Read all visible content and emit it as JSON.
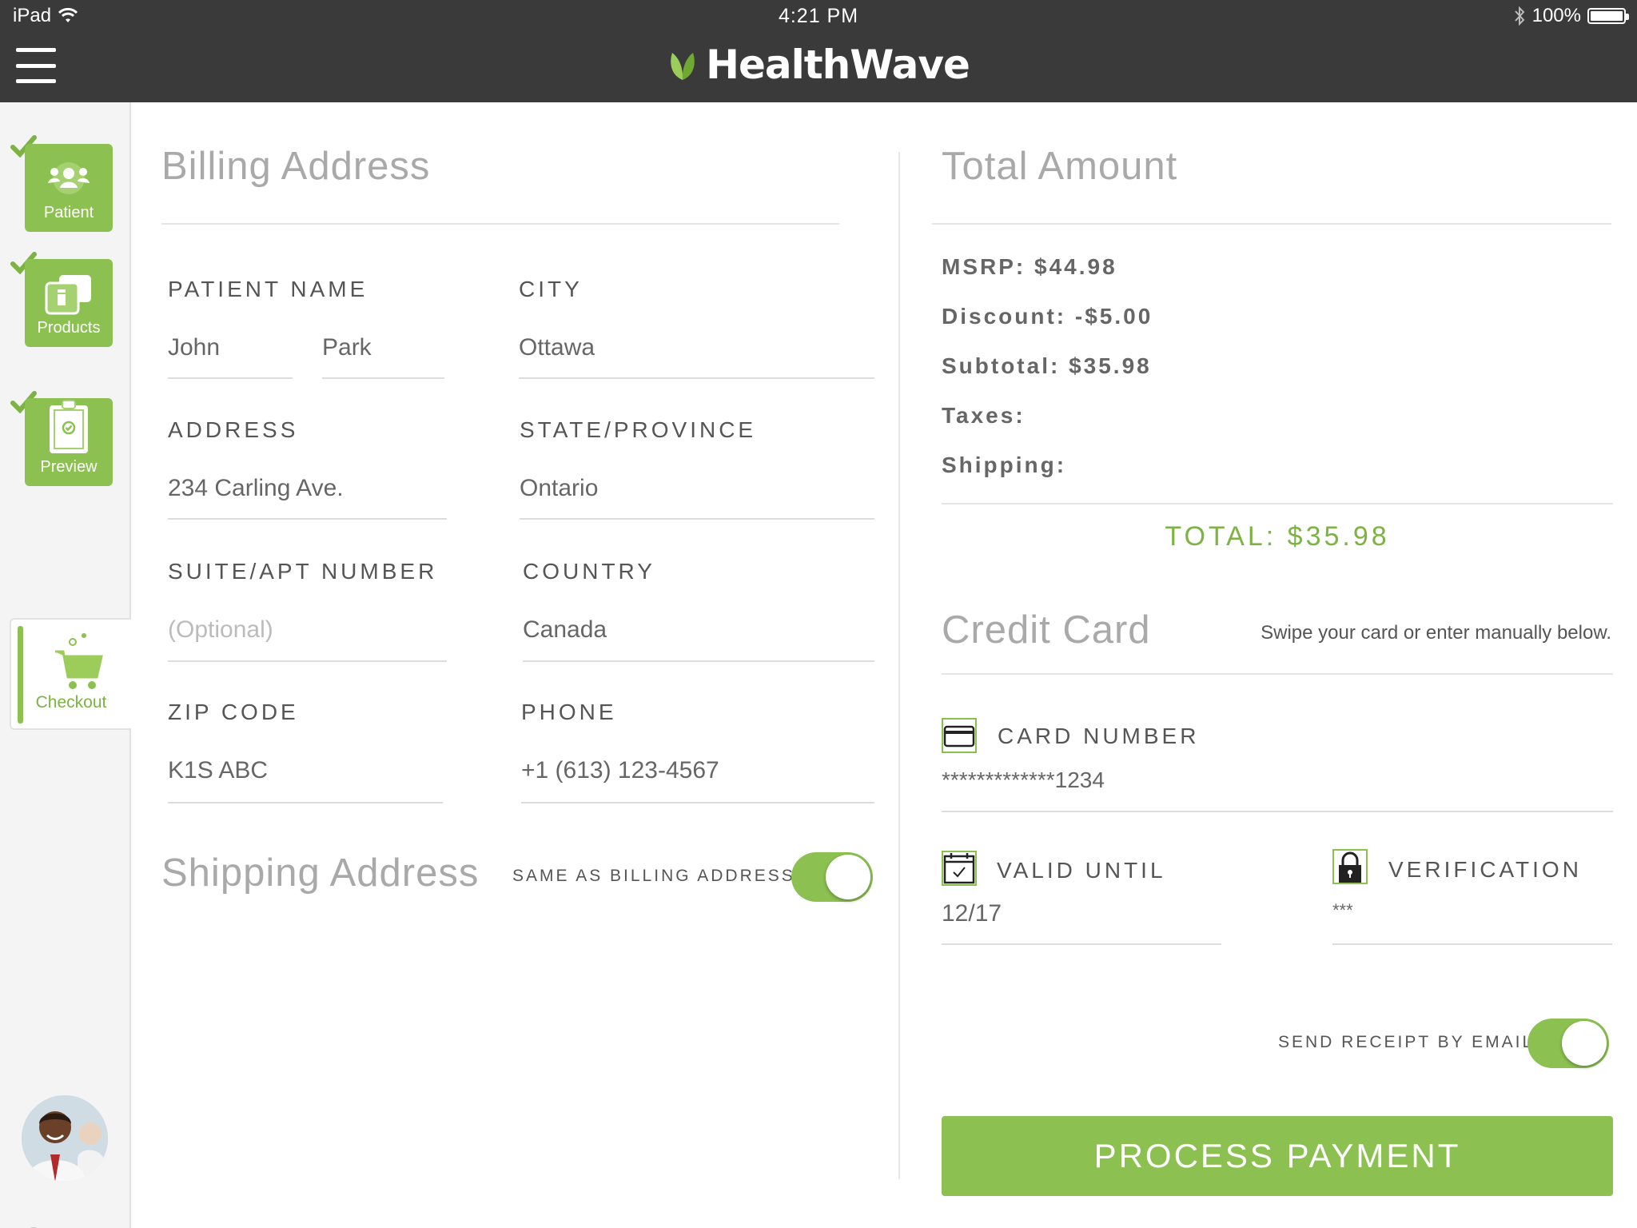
{
  "status_bar": {
    "device": "iPad",
    "time": "4:21 PM",
    "battery": "100%"
  },
  "header": {
    "brand": "HealthWave"
  },
  "sidebar": {
    "steps": [
      {
        "label": "Patient",
        "icon": "patient-icon",
        "completed": true
      },
      {
        "label": "Products",
        "icon": "products-icon",
        "completed": true
      },
      {
        "label": "Preview",
        "icon": "preview-icon",
        "completed": true
      },
      {
        "label": "Checkout",
        "icon": "cart-icon",
        "active": true
      }
    ],
    "step_indicator": "Step 4"
  },
  "billing": {
    "title": "Billing Address",
    "patient_name_label": "PATIENT NAME",
    "first_name": "John",
    "last_name": "Park",
    "city_label": "CITY",
    "city": "Ottawa",
    "address_label": "ADDRESS",
    "address": "234 Carling Ave.",
    "state_label": "STATE/PROVINCE",
    "state": "Ontario",
    "suite_label": "SUITE/APT NUMBER",
    "suite_placeholder": "(Optional)",
    "country_label": "COUNTRY",
    "country": "Canada",
    "zip_label": "ZIP CODE",
    "zip": "K1S ABC",
    "phone_label": "PHONE",
    "phone": "+1 (613) 123-4567"
  },
  "shipping": {
    "title": "Shipping Address",
    "same_as_billing_label": "SAME AS BILLING ADDRESS",
    "same_as_billing": true
  },
  "totals": {
    "title": "Total Amount",
    "msrp": "MSRP: $44.98",
    "discount": "Discount: -$5.00",
    "subtotal": "Subtotal: $35.98",
    "taxes": "Taxes:",
    "shipping": "Shipping:",
    "total": "TOTAL: $35.98"
  },
  "credit_card": {
    "title": "Credit Card",
    "hint": "Swipe your card or enter manually below.",
    "card_number_label": "CARD NUMBER",
    "card_number": "*************1234",
    "valid_until_label": "VALID UNTIL",
    "valid_until": "12/17",
    "verification_label": "VERIFICATION",
    "verification": "***"
  },
  "receipt": {
    "label": "SEND RECEIPT BY EMAIL",
    "enabled": true
  },
  "actions": {
    "process_payment": "PROCESS PAYMENT"
  },
  "colors": {
    "accent": "#8cc152",
    "topbar": "#3a3a3a",
    "sidebar": "#f4f4f4"
  }
}
